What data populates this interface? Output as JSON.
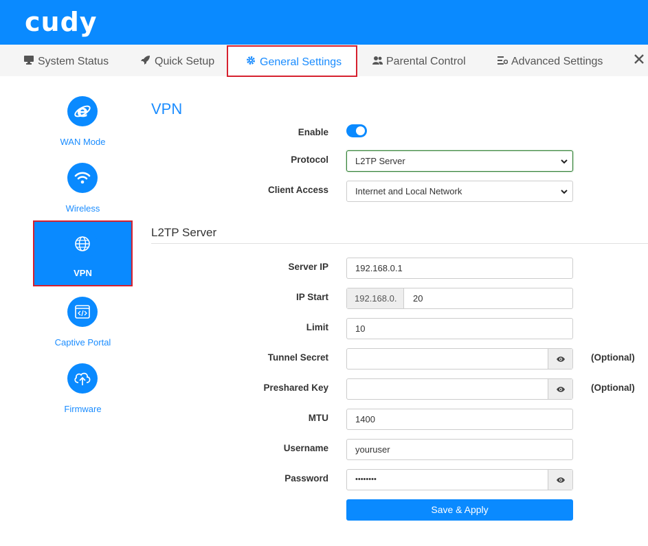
{
  "brand": {
    "logo": "cudy"
  },
  "nav": {
    "tabs": [
      {
        "label": "System Status",
        "icon": "monitor-icon"
      },
      {
        "label": "Quick Setup",
        "icon": "rocket-icon"
      },
      {
        "label": "General Settings",
        "icon": "gear-icon",
        "active": true
      },
      {
        "label": "Parental Control",
        "icon": "users-icon"
      },
      {
        "label": "Advanced Settings",
        "icon": "sliders-icon"
      }
    ]
  },
  "sidebar": {
    "items": [
      {
        "label": "WAN Mode",
        "icon": "internet-explorer-icon"
      },
      {
        "label": "Wireless",
        "icon": "wifi-icon"
      },
      {
        "label": "VPN",
        "icon": "globe-icon",
        "active": true
      },
      {
        "label": "Captive Portal",
        "icon": "browser-code-icon"
      },
      {
        "label": "Firmware",
        "icon": "cloud-upload-icon"
      }
    ]
  },
  "page": {
    "title": "VPN"
  },
  "vpn": {
    "enable_label": "Enable",
    "enable_value": true,
    "protocol_label": "Protocol",
    "protocol_value": "L2TP Server",
    "client_access_label": "Client Access",
    "client_access_value": "Internet and Local Network"
  },
  "l2tp": {
    "section_title": "L2TP Server",
    "server_ip_label": "Server IP",
    "server_ip_value": "192.168.0.1",
    "ip_start_label": "IP Start",
    "ip_start_prefix": "192.168.0.",
    "ip_start_value": "20",
    "limit_label": "Limit",
    "limit_value": "10",
    "tunnel_secret_label": "Tunnel Secret",
    "tunnel_secret_value": "",
    "preshared_key_label": "Preshared Key",
    "preshared_key_value": "",
    "optional_text": "(Optional)",
    "mtu_label": "MTU",
    "mtu_value": "1400",
    "username_label": "Username",
    "username_value": "youruser",
    "password_label": "Password",
    "password_value": "••••••••",
    "save_label": "Save & Apply"
  },
  "colors": {
    "accent": "#0a8aff",
    "highlight": "#d6202e"
  }
}
